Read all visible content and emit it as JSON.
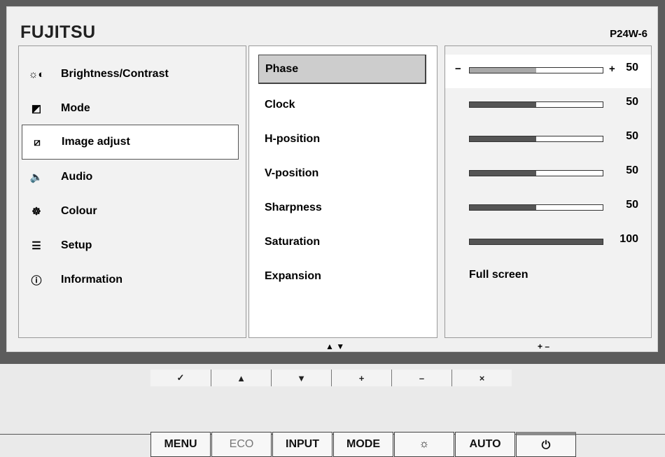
{
  "header": {
    "brand": "FUJITSU",
    "model": "P24W-6"
  },
  "menu": [
    {
      "label": "Brightness/Contrast",
      "icon": "sun-contrast-icon",
      "glyph": "☼◐"
    },
    {
      "label": "Mode",
      "icon": "mode-icon",
      "glyph": "◩"
    },
    {
      "label": "Image adjust",
      "icon": "image-adjust-icon",
      "glyph": "⧄",
      "selected": true
    },
    {
      "label": "Audio",
      "icon": "speaker-icon",
      "glyph": "🔈"
    },
    {
      "label": "Colour",
      "icon": "colour-icon",
      "glyph": "☸"
    },
    {
      "label": "Setup",
      "icon": "setup-icon",
      "glyph": "☰"
    },
    {
      "label": "Information",
      "icon": "info-icon",
      "glyph": "ⓘ"
    }
  ],
  "submenu": [
    {
      "label": "Phase",
      "selected": true
    },
    {
      "label": "Clock"
    },
    {
      "label": "H-position"
    },
    {
      "label": "V-position"
    },
    {
      "label": "Sharpness"
    },
    {
      "label": "Saturation"
    },
    {
      "label": "Expansion"
    }
  ],
  "values": [
    {
      "value": "50",
      "level": 0.5,
      "selected": true,
      "minus": "−",
      "plus": "+"
    },
    {
      "value": "50",
      "level": 0.5
    },
    {
      "value": "50",
      "level": 0.5
    },
    {
      "value": "50",
      "level": 0.5
    },
    {
      "value": "50",
      "level": 0.5
    },
    {
      "value": "100",
      "level": 1.0
    },
    {
      "text": "Full screen"
    }
  ],
  "hints": {
    "updown": "▲  ▼",
    "plusminus": "+  –"
  },
  "nav_buttons": [
    "✓",
    "▲",
    "▼",
    "+",
    "–",
    "×"
  ],
  "bottom_buttons": [
    "MENU",
    "ECO",
    "INPUT",
    "MODE",
    "☼",
    "AUTO",
    "⏻"
  ]
}
